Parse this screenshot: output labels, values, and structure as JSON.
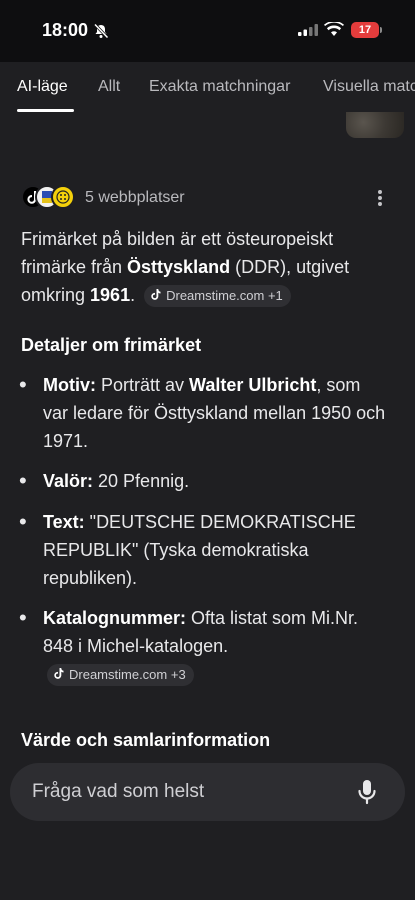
{
  "status": {
    "time": "18:00",
    "battery": "17"
  },
  "tabs": [
    {
      "label": "AI-läge"
    },
    {
      "label": "Allt"
    },
    {
      "label": "Exakta matchningar"
    },
    {
      "label": "Visuella matc"
    }
  ],
  "sources": {
    "label": "5 webbplatser"
  },
  "intro": {
    "t1": "Frimärket på bilden är ett östeuropeiskt frimärke från ",
    "b1": "Östtyskland",
    "t2": " (DDR), utgivet omkring ",
    "b2": "1961",
    "t3": ".",
    "chip": "Dreamstime.com +1"
  },
  "details_heading": "Detaljer om frimärket",
  "items": [
    {
      "label": "Motiv:",
      "t1": " Porträtt av ",
      "b1": "Walter Ulbricht",
      "t2": ", som var ledare för Östtyskland mellan 1950 och 1971."
    },
    {
      "label": "Valör:",
      "t1": " 20 Pfennig."
    },
    {
      "label": "Text:",
      "t1": " \"DEUTSCHE DEMOKRATISCHE REPUBLIK\" (Tyska demokratiska republiken)."
    },
    {
      "label": "Katalognummer:",
      "t1": " Ofta listat som Mi.Nr. 848 i Michel-katalogen.",
      "chip": "Dreamstime.com +3"
    }
  ],
  "value_heading": "Värde och samlarinformation",
  "search": {
    "placeholder": "Fråga vad som helst"
  },
  "colors": {
    "background": "#1f1f22",
    "chip": "#2f2f33",
    "battery": "#e33c3c"
  }
}
